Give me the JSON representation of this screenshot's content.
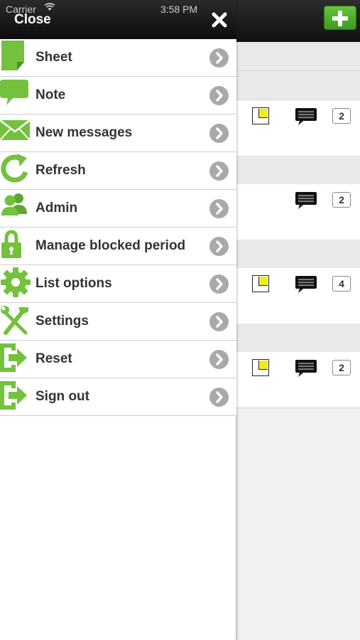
{
  "status_bar": {
    "carrier": "Carrier",
    "time": "3:58 PM"
  },
  "drawer": {
    "close_label": "Close",
    "items": [
      {
        "label": "Sheet",
        "icon": "sheet-icon"
      },
      {
        "label": "Note",
        "icon": "speech-bubble-icon"
      },
      {
        "label": "New messages",
        "icon": "envelope-icon"
      },
      {
        "label": "Refresh",
        "icon": "refresh-icon"
      },
      {
        "label": "Admin",
        "icon": "users-icon"
      },
      {
        "label": "Manage blocked period",
        "icon": "padlock-icon"
      },
      {
        "label": "List options",
        "icon": "gear-icon"
      },
      {
        "label": "Settings",
        "icon": "tools-icon"
      },
      {
        "label": "Reset",
        "icon": "exit-arrow-icon"
      },
      {
        "label": "Sign out",
        "icon": "exit-arrow-icon"
      }
    ]
  },
  "background_list": {
    "rows": [
      {
        "has_note": true,
        "has_comment": true,
        "count": "2"
      },
      {
        "has_note": false,
        "has_comment": true,
        "count": "2"
      },
      {
        "has_note": true,
        "has_comment": true,
        "count": "4"
      },
      {
        "has_note": true,
        "has_comment": true,
        "count": "2"
      }
    ]
  },
  "colors": {
    "accent_green": "#66bb33",
    "header_dark": "#1a1a1a",
    "chevron_gray": "#a9a9a9"
  }
}
